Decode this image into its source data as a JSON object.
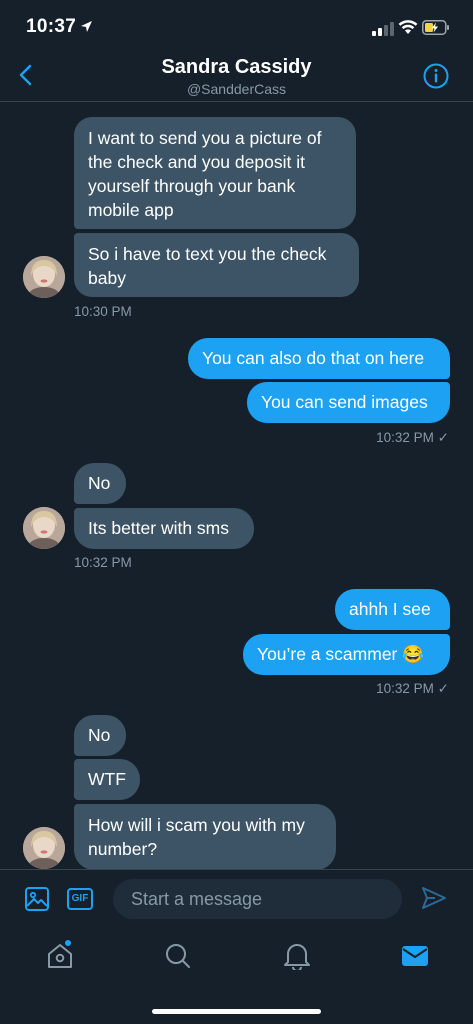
{
  "status_bar": {
    "time": "10:37"
  },
  "header": {
    "name": "Sandra Cassidy",
    "handle": "@SandderCass"
  },
  "messages": {
    "m1": "I want to send you a picture of the check and you deposit it yourself through your bank mobile app",
    "m2": "So i have to text you the check baby",
    "t1": "10:30 PM",
    "m3": "You can also do that on here",
    "m4": "You can send images",
    "t2": "10:32 PM ✓",
    "m5": "No",
    "m6": "Its better with sms",
    "t3": "10:32 PM",
    "m7": "ahhh I see",
    "m8": "You’re a scammer 😂",
    "t4": "10:32 PM ✓",
    "m9": "No",
    "m10": "WTF",
    "m11": "How will i scam you with my number?"
  },
  "composer": {
    "placeholder": "Start a message",
    "gif_label": "GIF"
  },
  "colors": {
    "background": "#15202b",
    "incoming": "#3d5466",
    "outgoing": "#1da1f2",
    "muted": "#8899a6"
  },
  "icons": [
    "location-arrow-icon",
    "signal-icon",
    "wifi-icon",
    "battery-charging-icon",
    "back-chevron-icon",
    "info-icon",
    "image-icon",
    "send-icon",
    "home-icon",
    "search-icon",
    "bell-icon",
    "mail-icon"
  ]
}
